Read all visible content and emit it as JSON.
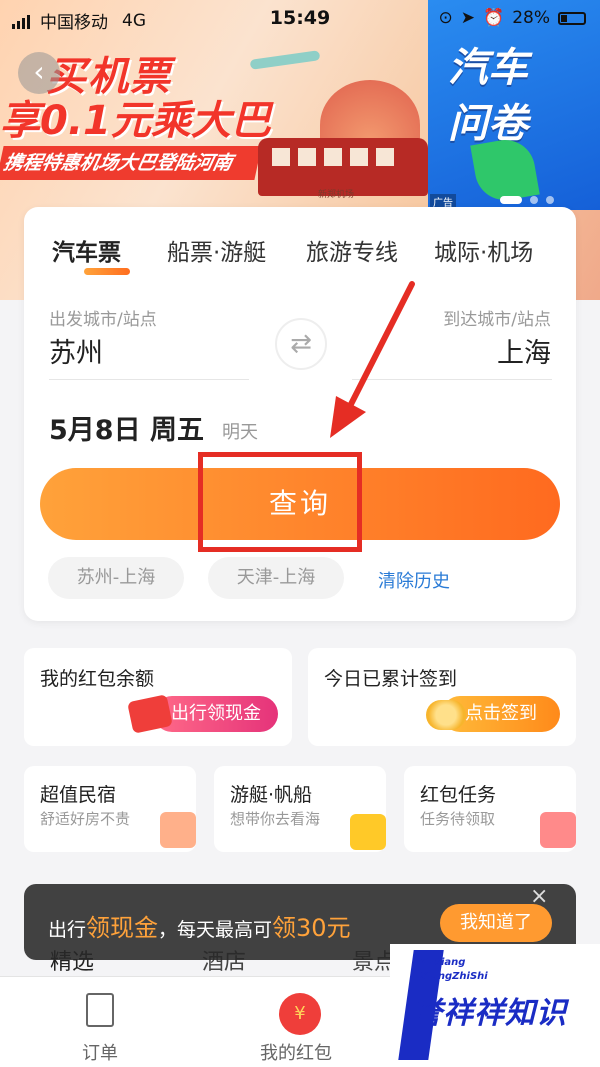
{
  "status_bar": {
    "carrier": "中国移动",
    "network": "4G",
    "time": "15:49",
    "battery": "28%"
  },
  "banner": {
    "title": "买机票",
    "subtitle": "享0.1元乘大巴",
    "tagline": "携程特惠机场大巴登陆河南",
    "bus_label": "新郑机场",
    "side_text_1": "汽车",
    "side_text_2": "问卷",
    "ad_label": "广告",
    "slide_count": 3,
    "active_slide": 1
  },
  "tabs": [
    {
      "label": "汽车票",
      "active": true
    },
    {
      "label": "船票·游艇",
      "active": false
    },
    {
      "label": "旅游专线",
      "active": false
    },
    {
      "label": "城际·机场",
      "active": false
    }
  ],
  "search": {
    "from_label": "出发城市/站点",
    "from_city": "苏州",
    "to_label": "到达城市/站点",
    "to_city": "上海",
    "date": "5月8日 周五",
    "date_note": "明天",
    "query_button": "查询",
    "history": [
      "苏州-上海",
      "天津-上海"
    ],
    "clear_history": "清除历史"
  },
  "promos": {
    "red_packet": {
      "title": "我的红包余额",
      "button": "出行领现金"
    },
    "sign_in": {
      "title": "今日已累计签到",
      "button": "点击签到"
    }
  },
  "services": [
    {
      "title": "超值民宿",
      "subtitle": "舒适好房不贵"
    },
    {
      "title": "游艇·帆船",
      "subtitle": "想带你去看海"
    },
    {
      "title": "红包任务",
      "subtitle": "任务待领取"
    }
  ],
  "toast": {
    "prefix": "出行",
    "highlight1": "领现金",
    "middle": "，每天最高可",
    "highlight2": "领30元",
    "button": "我知道了",
    "close": "×"
  },
  "sections": [
    "精选",
    "酒店",
    "景点"
  ],
  "tabbar": {
    "orders": "订单",
    "red_packet": "我的红包",
    "red_packet_icon": "¥"
  },
  "watermark": {
    "small_line1": "YuXiang",
    "small_line2": "XiangZhiShi",
    "big": "誉祥祥知识"
  },
  "colors": {
    "accent": "#ff7a24",
    "annotation": "#e52d24",
    "link": "#2a7bd6",
    "watermark": "#1a2cc4"
  }
}
